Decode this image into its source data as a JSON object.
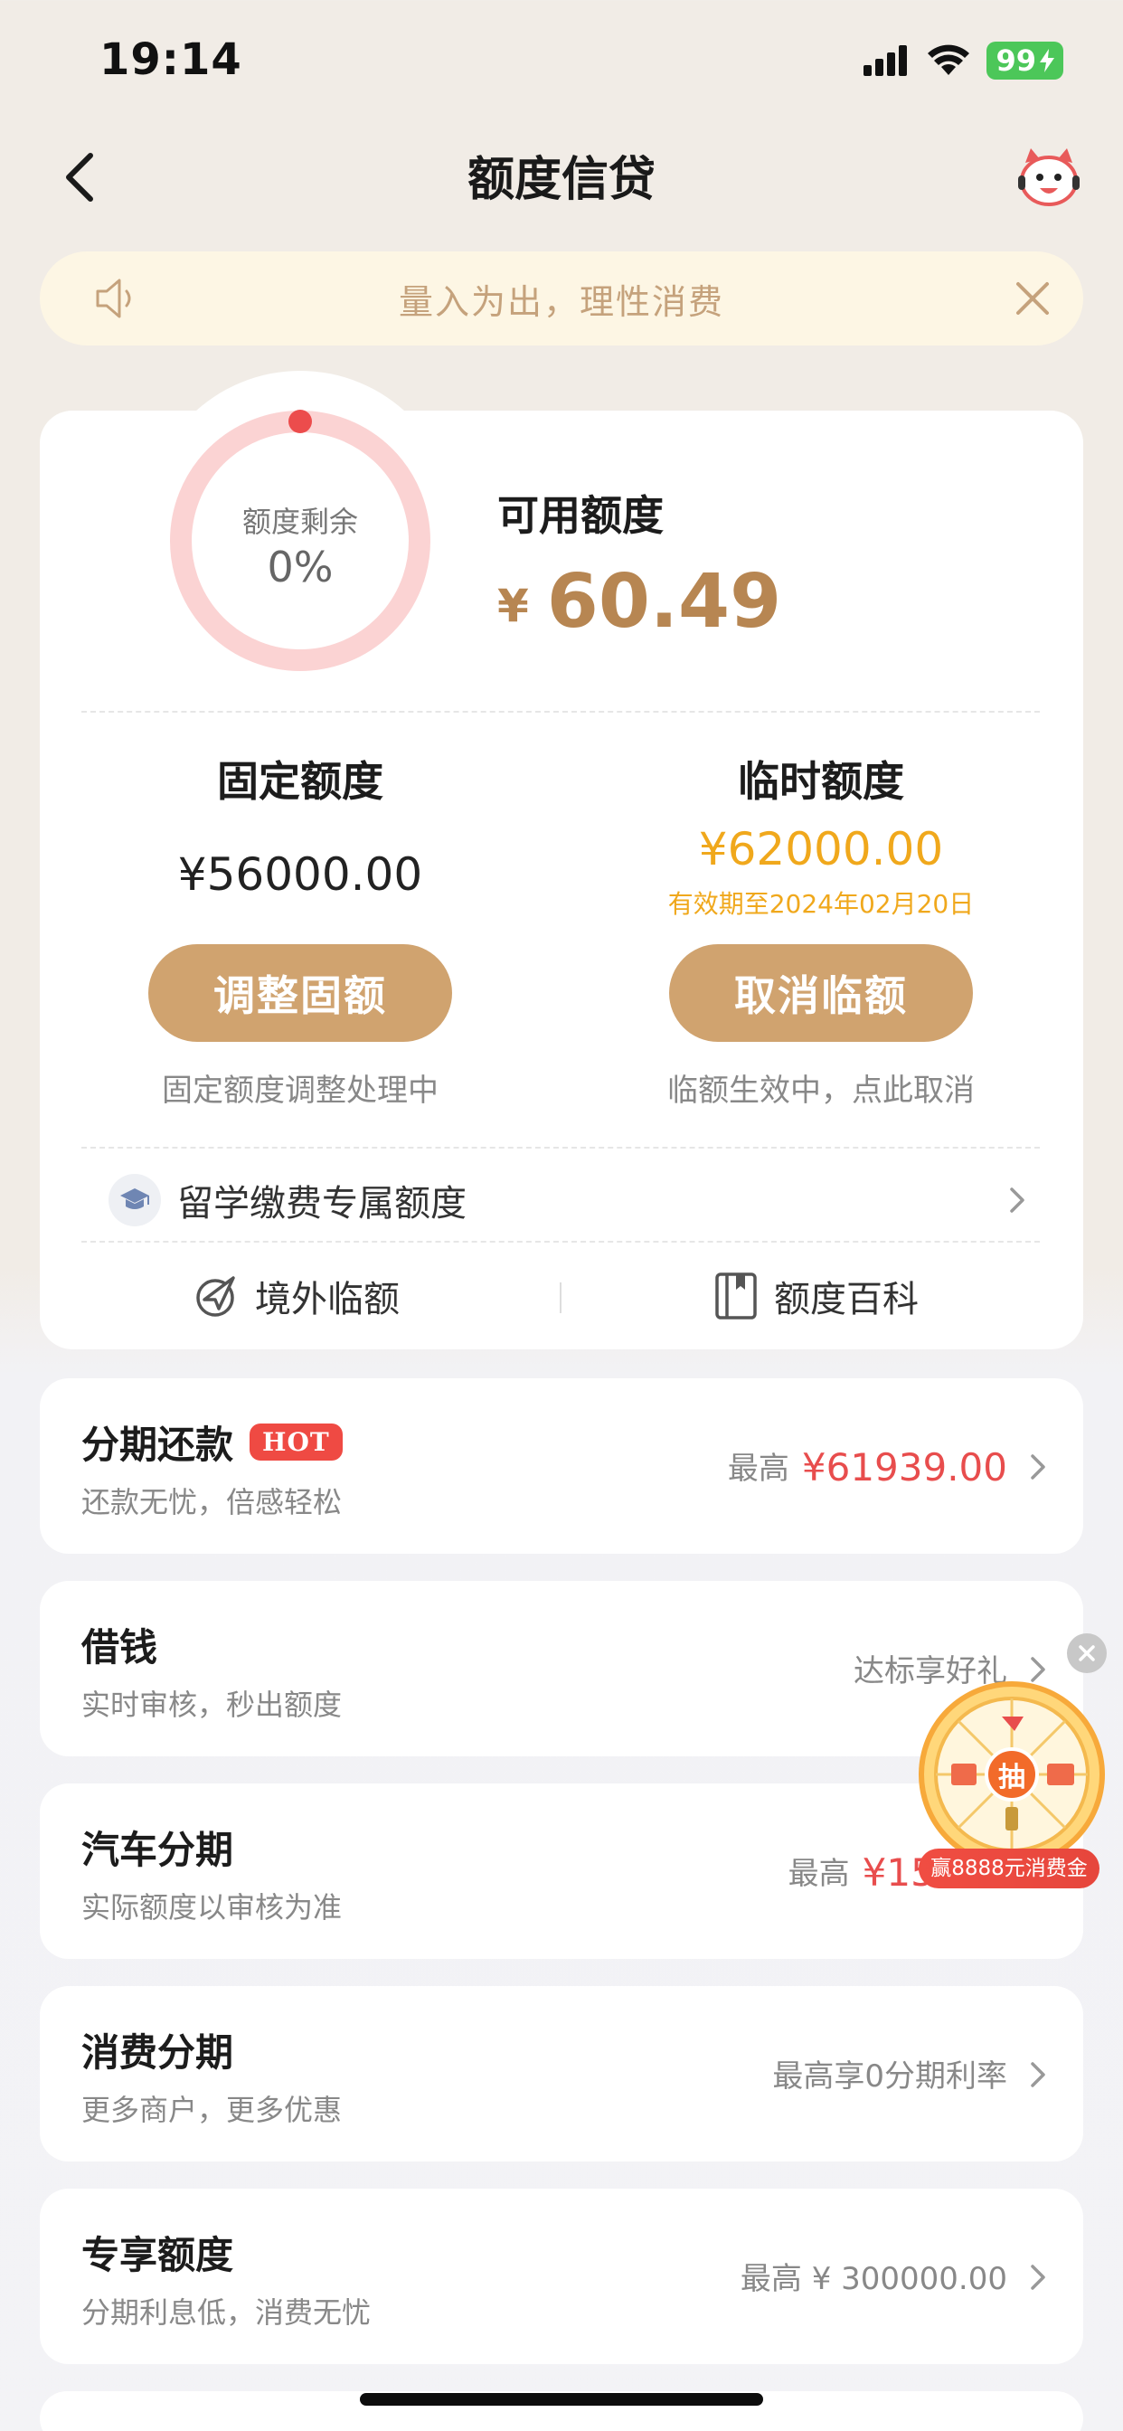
{
  "status_bar": {
    "time": "19:14",
    "battery": "99"
  },
  "nav": {
    "title": "额度信贷"
  },
  "notice": {
    "text": "量入为出，理性消费"
  },
  "credit": {
    "remaining_label": "额度剩余",
    "remaining_percent_text": "0%",
    "remaining_fraction": 0.0,
    "available_label": "可用额度",
    "available_currency": "¥",
    "available_amount": "60.49",
    "fixed": {
      "title": "固定额度",
      "amount": "¥56000.00",
      "button": "调整固额",
      "note": "固定额度调整处理中"
    },
    "temporary": {
      "title": "临时额度",
      "amount": "¥62000.00",
      "valid_until": "有效期至2024年02月20日",
      "button": "取消临额",
      "note": "临额生效中，点此取消"
    },
    "study_abroad_label": "留学缴费专属额度",
    "links": {
      "overseas": "境外临额",
      "encyclopedia": "额度百科"
    }
  },
  "products": [
    {
      "title": "分期还款",
      "badge": "HOT",
      "subtitle": "还款无忧，倍感轻松",
      "right_prefix": "最高",
      "right_value": "¥61939.00"
    },
    {
      "title": "借钱",
      "subtitle": "实时审核，秒出额度",
      "right_prefix": "达标享好礼",
      "right_value": ""
    },
    {
      "title": "汽车分期",
      "subtitle": "实际额度以审核为准",
      "right_prefix": "最高",
      "right_value": "¥15000"
    },
    {
      "title": "消费分期",
      "subtitle": "更多商户，更多优惠",
      "right_prefix": "最高享0分期利率",
      "right_value": ""
    },
    {
      "title": "专享额度",
      "subtitle": "分期利息低，消费无忧",
      "right_prefix": "最高 ¥ 300000.00",
      "right_value": ""
    }
  ],
  "promo": {
    "wheel_center": "抽",
    "banner": "赢8888元消费金"
  },
  "colors": {
    "accent_gold": "#d0a36f",
    "amount_gold": "#b78652",
    "temp_orange": "#f0a81c",
    "red": "#e84d4d",
    "ring_pink": "#fbd3d3"
  }
}
